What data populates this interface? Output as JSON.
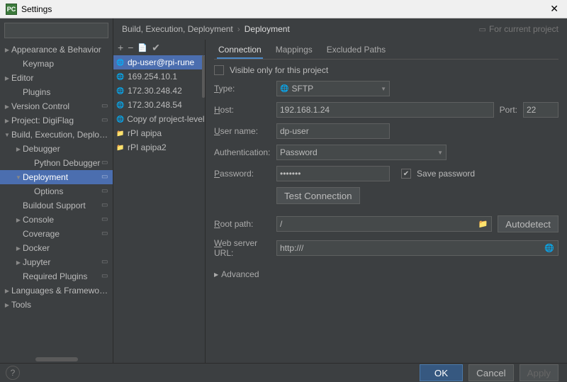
{
  "title": "Settings",
  "search": {
    "placeholder": ""
  },
  "sidebar": {
    "items": [
      {
        "label": "Appearance & Behavior",
        "depth": 0,
        "arrow": "right",
        "badge": false
      },
      {
        "label": "Keymap",
        "depth": 1,
        "arrow": "none",
        "badge": false
      },
      {
        "label": "Editor",
        "depth": 0,
        "arrow": "right",
        "badge": false
      },
      {
        "label": "Plugins",
        "depth": 1,
        "arrow": "none",
        "badge": false
      },
      {
        "label": "Version Control",
        "depth": 0,
        "arrow": "right",
        "badge": true
      },
      {
        "label": "Project: DigiFlag",
        "depth": 0,
        "arrow": "right",
        "badge": true
      },
      {
        "label": "Build, Execution, Deployment",
        "depth": 0,
        "arrow": "down",
        "badge": false
      },
      {
        "label": "Debugger",
        "depth": 1,
        "arrow": "right",
        "badge": false
      },
      {
        "label": "Python Debugger",
        "depth": 2,
        "arrow": "none",
        "badge": true
      },
      {
        "label": "Deployment",
        "depth": 1,
        "arrow": "down",
        "badge": true,
        "selected": true
      },
      {
        "label": "Options",
        "depth": 2,
        "arrow": "none",
        "badge": true
      },
      {
        "label": "Buildout Support",
        "depth": 1,
        "arrow": "none",
        "badge": true
      },
      {
        "label": "Console",
        "depth": 1,
        "arrow": "right",
        "badge": true
      },
      {
        "label": "Coverage",
        "depth": 1,
        "arrow": "none",
        "badge": true
      },
      {
        "label": "Docker",
        "depth": 1,
        "arrow": "right",
        "badge": false
      },
      {
        "label": "Jupyter",
        "depth": 1,
        "arrow": "right",
        "badge": true
      },
      {
        "label": "Required Plugins",
        "depth": 1,
        "arrow": "none",
        "badge": true
      },
      {
        "label": "Languages & Frameworks",
        "depth": 0,
        "arrow": "right",
        "badge": false
      },
      {
        "label": "Tools",
        "depth": 0,
        "arrow": "right",
        "badge": false
      }
    ]
  },
  "breadcrumb": {
    "parts": [
      "Build, Execution, Deployment",
      "Deployment"
    ],
    "for_current_project": "For current project"
  },
  "servers": {
    "items": [
      {
        "label": "dp-user@rpi-rune",
        "icon": "web",
        "selected": true
      },
      {
        "label": "169.254.10.1",
        "icon": "web"
      },
      {
        "label": "172.30.248.42",
        "icon": "web"
      },
      {
        "label": "172.30.248.54",
        "icon": "web"
      },
      {
        "label": "Copy of project-level serv",
        "icon": "web"
      },
      {
        "label": "rPI apipa",
        "icon": "local"
      },
      {
        "label": "rPI apipa2",
        "icon": "local"
      }
    ]
  },
  "tabs": {
    "items": [
      "Connection",
      "Mappings",
      "Excluded Paths"
    ],
    "active": 0
  },
  "form": {
    "visible_only_label": "Visible only for this project",
    "visible_only_checked": false,
    "type_label": "Type:",
    "type_value": "SFTP",
    "host_label": "Host:",
    "host_value": "192.168.1.24",
    "port_label": "Port:",
    "port_value": "22",
    "user_label": "User name:",
    "user_value": "dp-user",
    "auth_label": "Authentication:",
    "auth_value": "Password",
    "password_label": "Password:",
    "password_value": "•••••••",
    "save_password_label": "Save password",
    "save_password_checked": true,
    "test_connection": "Test Connection",
    "root_label": "Root path:",
    "root_value": "/",
    "autodetect": "Autodetect",
    "weburl_label": "Web server URL:",
    "weburl_value": "http:///",
    "advanced": "Advanced"
  },
  "footer": {
    "ok": "OK",
    "cancel": "Cancel",
    "apply": "Apply"
  }
}
